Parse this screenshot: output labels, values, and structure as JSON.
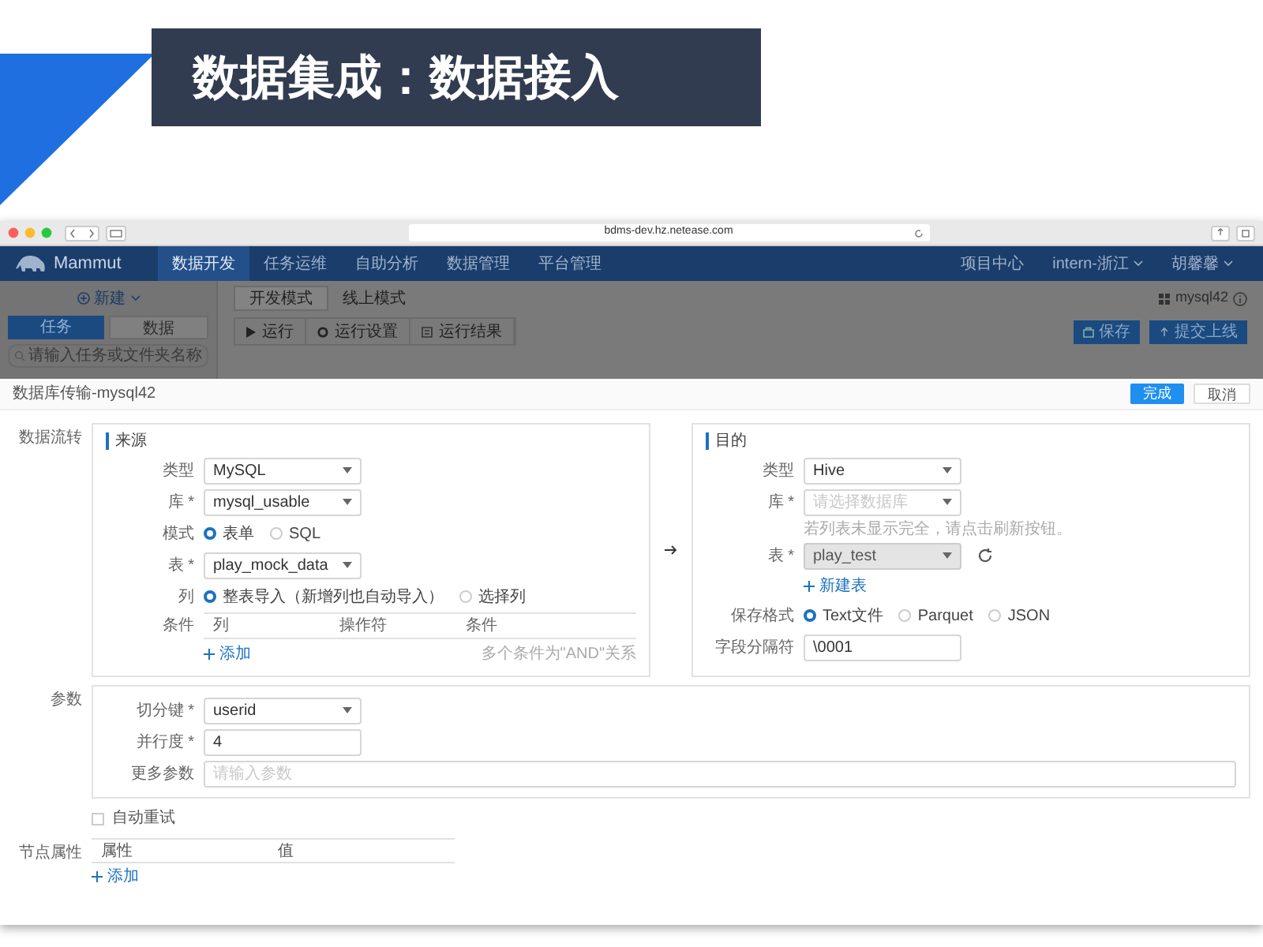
{
  "slide": {
    "title": "数据集成：数据接入"
  },
  "browser": {
    "url": "bdms-dev.hz.netease.com"
  },
  "app": {
    "logo": "Mammut",
    "nav": [
      {
        "label": "数据开发",
        "selected": true
      },
      {
        "label": "任务运维",
        "selected": false
      },
      {
        "label": "自助分析",
        "selected": false
      },
      {
        "label": "数据管理",
        "selected": false
      },
      {
        "label": "平台管理",
        "selected": false
      }
    ],
    "right_menu": [
      {
        "label": "项目中心",
        "dropdown": false
      },
      {
        "label": "intern-浙江",
        "dropdown": true
      },
      {
        "label": "胡馨馨",
        "dropdown": true
      }
    ]
  },
  "sidebar": {
    "new_button": "新建",
    "tabs": [
      {
        "label": "任务",
        "selected": true
      },
      {
        "label": "数据",
        "selected": false
      }
    ],
    "search": {
      "placeholder": "请输入任务或文件夹名称"
    }
  },
  "mode_tabs": [
    {
      "label": "开发模式",
      "selected": true
    },
    {
      "label": "线上模式",
      "selected": false
    }
  ],
  "toolbar": [
    {
      "label": "运行",
      "kind": "play"
    },
    {
      "label": "运行设置",
      "kind": "settings"
    },
    {
      "label": "运行结果",
      "kind": "results"
    }
  ],
  "task_name": "mysql42",
  "actions": [
    {
      "label": "保存",
      "kind": "save"
    },
    {
      "label": "提交上线",
      "kind": "submit"
    }
  ],
  "modal": {
    "title": "数据库传输-mysql42",
    "buttons": [
      {
        "label": "完成",
        "primary": true
      },
      {
        "label": "取消",
        "primary": false
      }
    ],
    "flow_label": "数据流转",
    "source": {
      "title": "来源",
      "fields": [
        {
          "kind": "select",
          "label": "类型",
          "value": "MySQL",
          "disabled": false,
          "refresh": false
        },
        {
          "kind": "select",
          "label": "库 *",
          "value": "mysql_usable",
          "disabled": false,
          "refresh": false
        },
        {
          "kind": "radio",
          "label": "模式",
          "options": [
            {
              "label": "表单",
              "selected": true
            },
            {
              "label": "SQL",
              "selected": false
            }
          ]
        },
        {
          "kind": "select",
          "label": "表 *",
          "value": "play_mock_data",
          "disabled": false,
          "refresh": false
        },
        {
          "kind": "radio",
          "label": "列",
          "options": [
            {
              "label": "整表导入（新增列也自动导入）",
              "selected": true
            },
            {
              "label": "选择列",
              "selected": false
            }
          ]
        },
        {
          "kind": "table",
          "label": "条件",
          "columns": [
            "列",
            "操作符",
            "条件"
          ],
          "add": "添加",
          "note": "多个条件为\"AND\"关系"
        }
      ]
    },
    "target": {
      "title": "目的",
      "fields": [
        {
          "kind": "select",
          "label": "类型",
          "value": "Hive",
          "disabled": false,
          "refresh": false
        },
        {
          "kind": "select",
          "label": "库 *",
          "placeholder": "请选择数据库",
          "disabled": false,
          "refresh": false
        },
        {
          "kind": "hint",
          "text": "若列表未显示完全，请点击刷新按钮。"
        },
        {
          "kind": "select",
          "label": "表 *",
          "value": "play_test",
          "disabled": true,
          "refresh": true
        },
        {
          "kind": "link",
          "text": "新建表"
        },
        {
          "kind": "radio",
          "label": "保存格式",
          "options": [
            {
              "label": "Text文件",
              "selected": true
            },
            {
              "label": "Parquet",
              "selected": false
            },
            {
              "label": "JSON",
              "selected": false
            }
          ]
        },
        {
          "kind": "input",
          "label": "字段分隔符",
          "value": "\\0001"
        }
      ]
    },
    "params": {
      "label": "参数",
      "fields": [
        {
          "kind": "select",
          "label": "切分键 *",
          "value": "userid",
          "disabled": false,
          "refresh": false
        },
        {
          "kind": "input",
          "label": "并行度 *",
          "value": "4"
        },
        {
          "kind": "wide_input",
          "label": "更多参数",
          "placeholder": "请输入参数"
        }
      ]
    },
    "auto_retry": {
      "label": "自动重试",
      "checked": false
    },
    "node_props": {
      "label": "节点属性",
      "columns": [
        "属性",
        "值"
      ],
      "add": "添加"
    }
  }
}
